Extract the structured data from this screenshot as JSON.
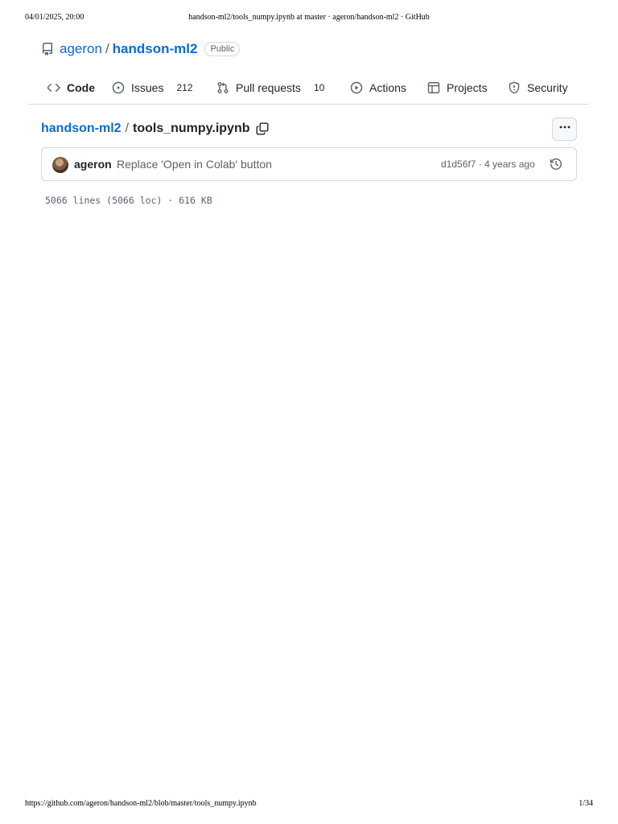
{
  "print_header": {
    "datetime": "04/01/2025, 20:00",
    "page_title": "handson-ml2/tools_numpy.ipynb at master · ageron/handson-ml2 · GitHub"
  },
  "repo": {
    "owner": "ageron",
    "separator": "/",
    "name": "handson-ml2",
    "visibility": "Public"
  },
  "nav_tabs": [
    {
      "label": "Code",
      "icon": "code-icon",
      "selected": true
    },
    {
      "label": "Issues",
      "icon": "issue-opened-icon",
      "count": "212"
    },
    {
      "label": "Pull requests",
      "icon": "git-pull-request-icon",
      "count": "10"
    },
    {
      "label": "Actions",
      "icon": "play-icon"
    },
    {
      "label": "Projects",
      "icon": "table-icon"
    },
    {
      "label": "Security",
      "icon": "shield-icon"
    }
  ],
  "breadcrumb": {
    "repo": "handson-ml2",
    "separator": "/",
    "file": "tools_numpy.ipynb"
  },
  "commit": {
    "author": "ageron",
    "message": "Replace 'Open in Colab' button",
    "meta": "d1d56f7 · 4 years ago"
  },
  "file_info": "5066 lines (5066 loc) · 616 KB",
  "print_footer": {
    "url": "https://github.com/ageron/handson-ml2/blob/master/tools_numpy.ipynb",
    "page": "1/34"
  },
  "colors": {
    "link": "#0969da",
    "text": "#1f2328",
    "muted": "#59636e",
    "border": "#d1d9e0"
  }
}
